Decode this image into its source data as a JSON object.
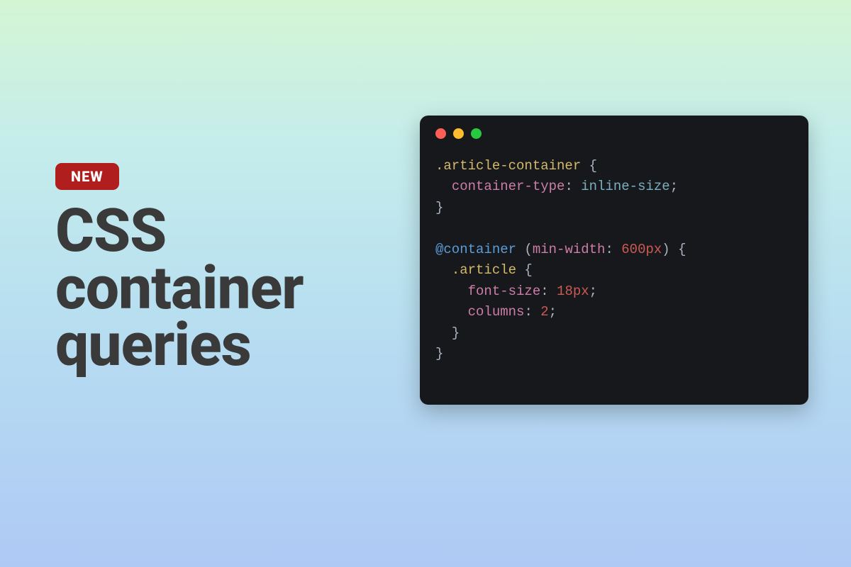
{
  "badge": {
    "label": "NEW"
  },
  "headline": {
    "line1": "CSS",
    "line2": "container",
    "line3": "queries"
  },
  "code": {
    "selector1": ".article-container",
    "brace_open": " {",
    "prop1": "container-type",
    "colon_sp": ": ",
    "val1": "inline-size",
    "semicolon": ";",
    "brace_close": "}",
    "at_rule": "@container",
    "query_open": " (",
    "query_prop": "min-width",
    "query_num": "600px",
    "query_close": ") {",
    "selector2": ".article",
    "prop2": "font-size",
    "val2": "18px",
    "prop3": "columns",
    "val3": "2",
    "indent1": "  ",
    "indent2": "    "
  }
}
